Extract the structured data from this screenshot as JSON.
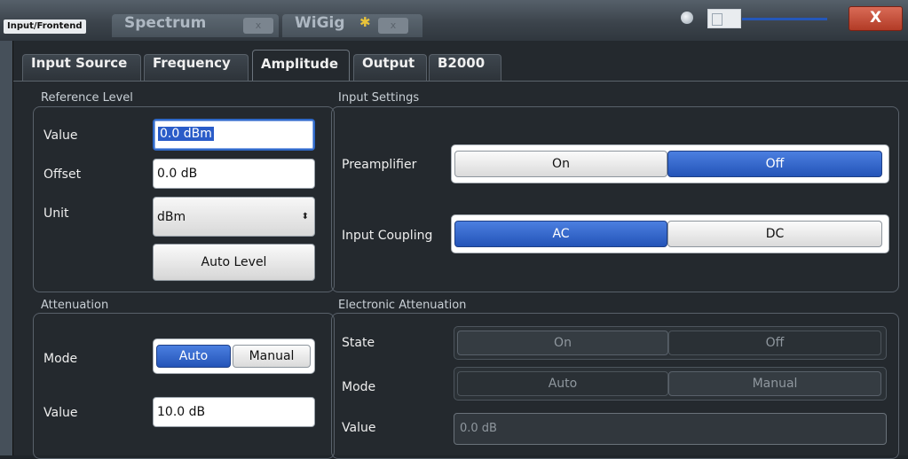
{
  "titlebar": {
    "tag": "Input/Frontend",
    "tabs": [
      {
        "label": "Spectrum",
        "close": "x"
      },
      {
        "label": "WiGig",
        "close": "x",
        "icon": "star-icon"
      }
    ],
    "close_label": "X"
  },
  "tabs": [
    "Input Source",
    "Frequency",
    "Amplitude",
    "Output",
    "B2000"
  ],
  "active_tab": "Amplitude",
  "reference_level": {
    "title": "Reference Level",
    "value_label": "Value",
    "value": "0.0 dBm",
    "offset_label": "Offset",
    "offset": "0.0 dB",
    "unit_label": "Unit",
    "unit": "dBm",
    "auto_level": "Auto Level"
  },
  "input_settings": {
    "title": "Input Settings",
    "preamp_label": "Preamplifier",
    "preamp_on": "On",
    "preamp_off": "Off",
    "preamp_selected": "Off",
    "coupling_label": "Input Coupling",
    "coupling_ac": "AC",
    "coupling_dc": "DC",
    "coupling_selected": "AC"
  },
  "attenuation": {
    "title": "Attenuation",
    "mode_label": "Mode",
    "mode_auto": "Auto",
    "mode_manual": "Manual",
    "mode_selected": "Auto",
    "value_label": "Value",
    "value": "10.0 dB"
  },
  "electronic_attenuation": {
    "title": "Electronic Attenuation",
    "state_label": "State",
    "state_on": "On",
    "state_off": "Off",
    "mode_label": "Mode",
    "mode_auto": "Auto",
    "mode_manual": "Manual",
    "value_label": "Value",
    "value": "0.0 dB"
  },
  "colors": {
    "accent": "#2454b8",
    "background": "#24292e",
    "close": "#c2452f"
  }
}
